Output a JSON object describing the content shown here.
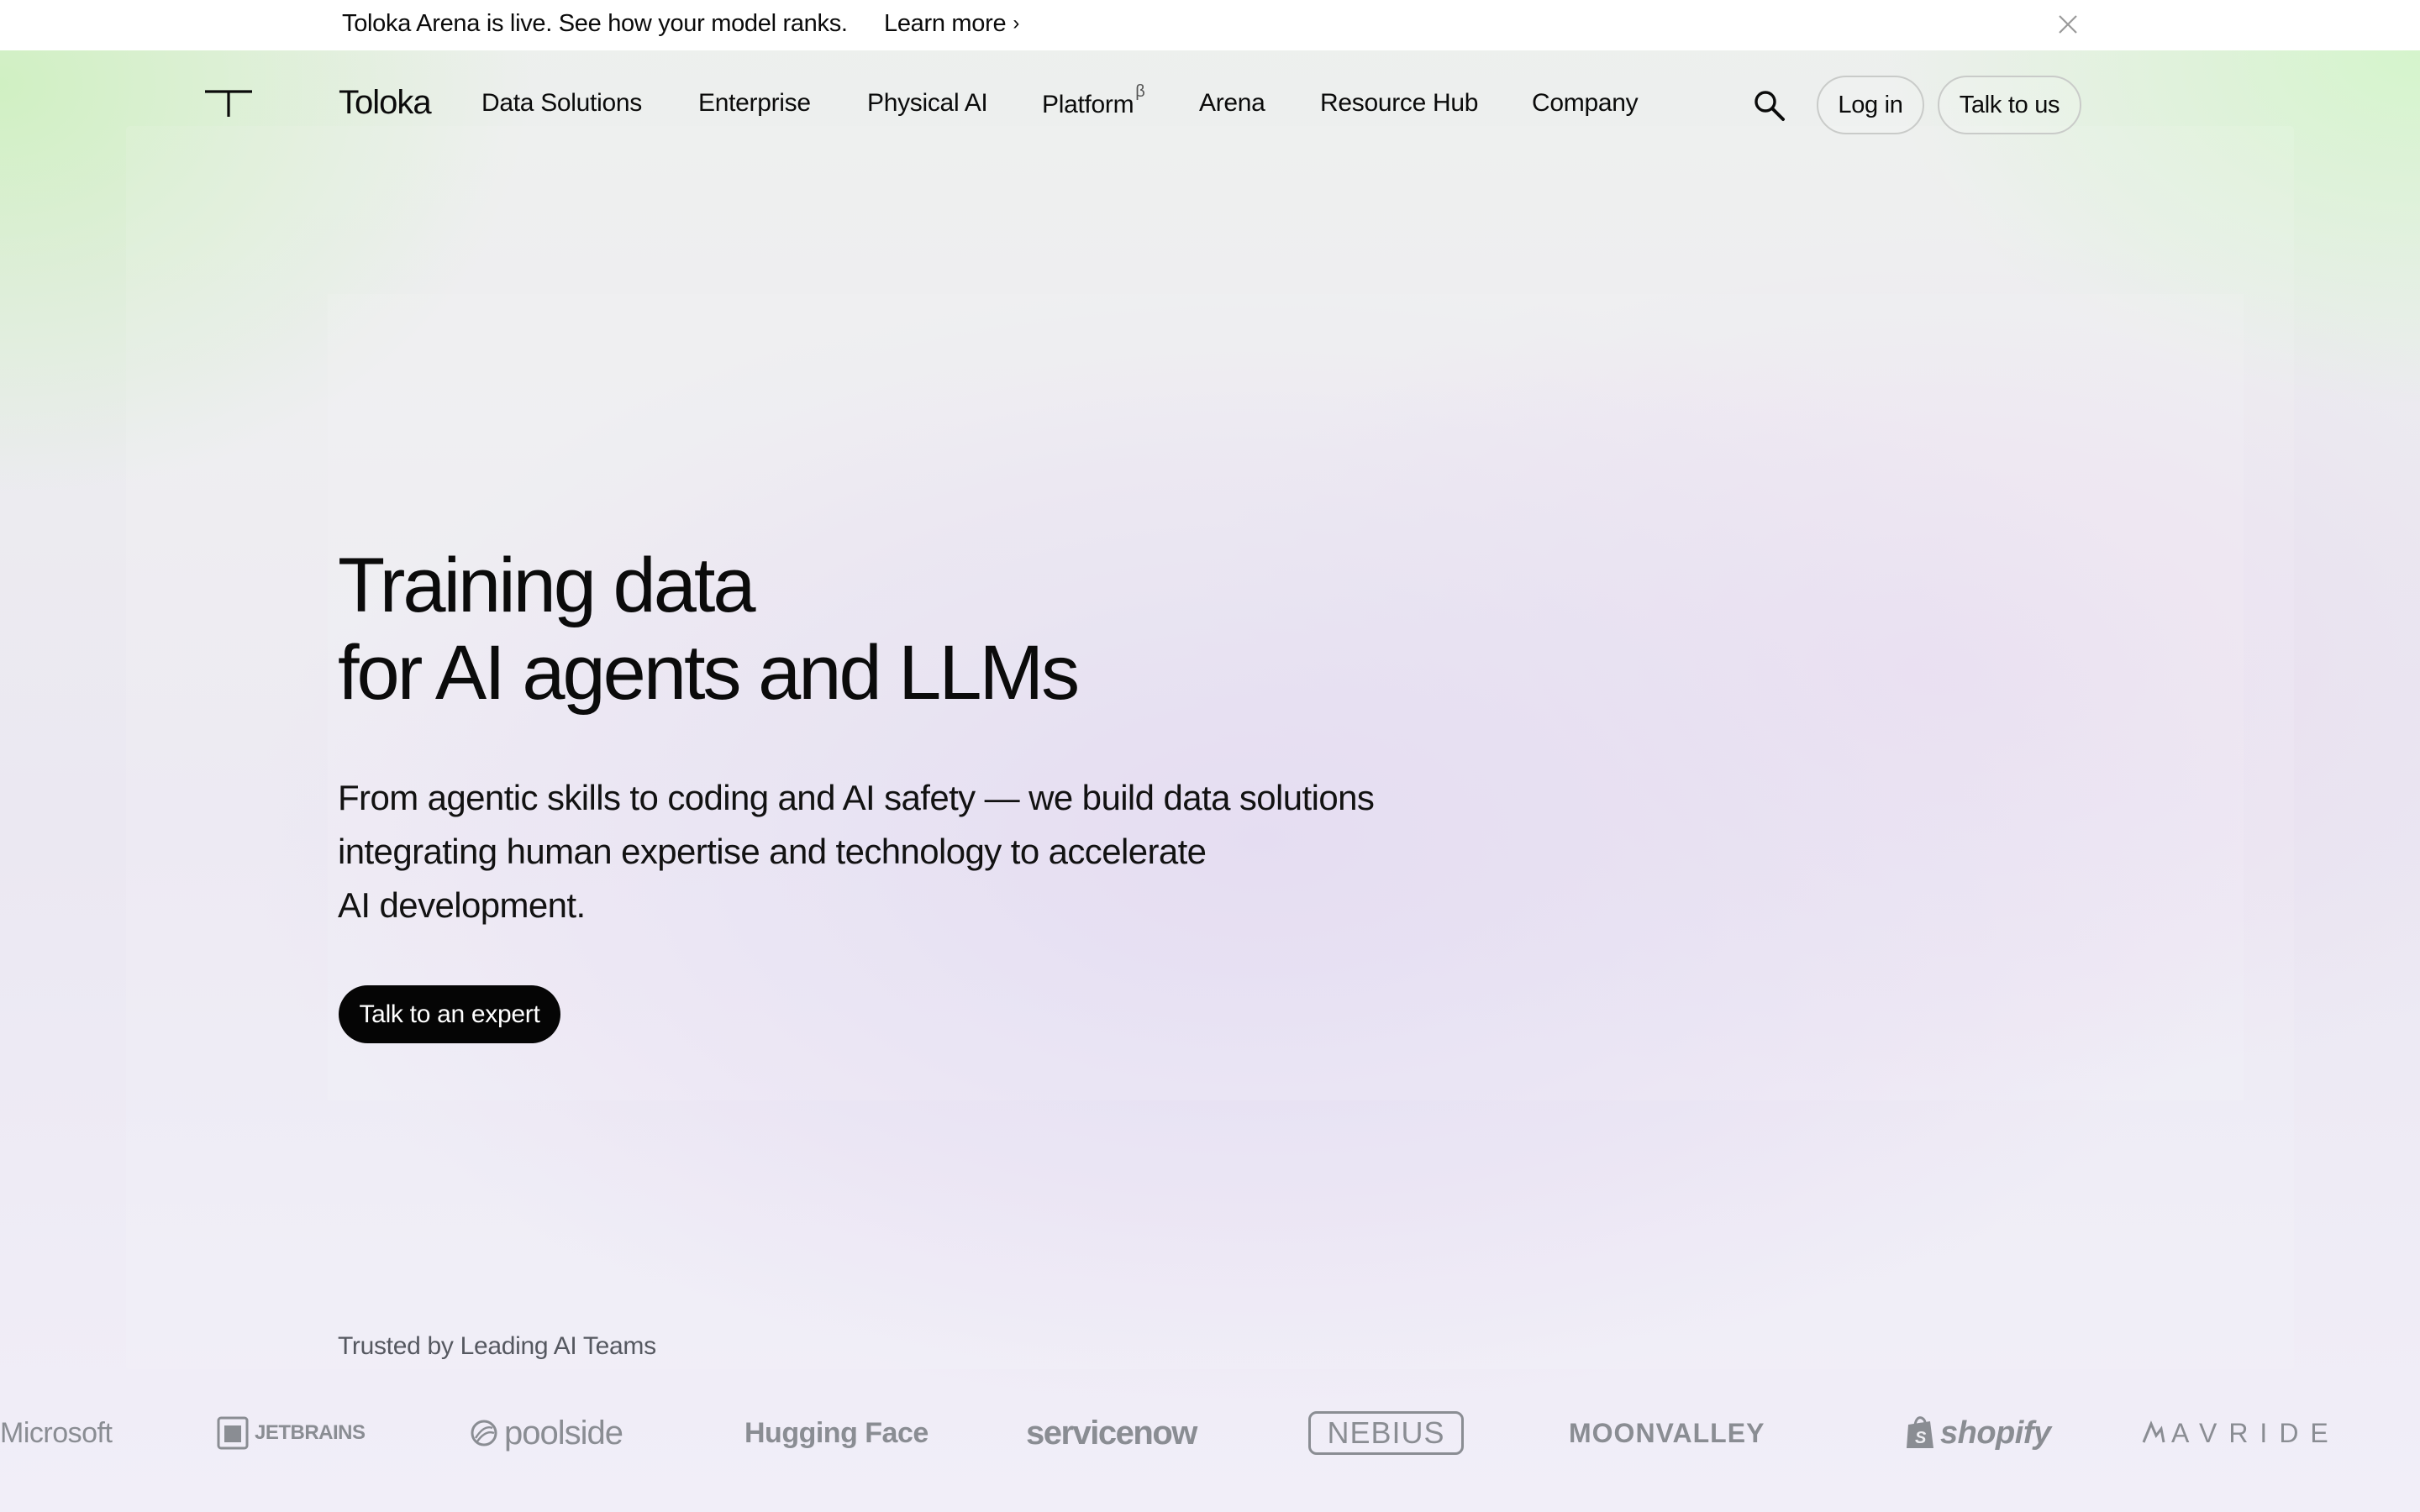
{
  "announcement": {
    "text": "Toloka Arena is live. See how your model ranks.",
    "link_label": "Learn more",
    "link_chevron": "›",
    "close_icon": "close-icon"
  },
  "header": {
    "brand": "Toloka",
    "logo_icon": "toloka-t-logo",
    "nav": [
      {
        "label": "Data Solutions"
      },
      {
        "label": "Enterprise"
      },
      {
        "label": "Physical AI"
      },
      {
        "label": "Platform",
        "superscript": "β"
      },
      {
        "label": "Arena"
      },
      {
        "label": "Resource Hub"
      },
      {
        "label": "Company"
      }
    ],
    "search_icon": "search-icon",
    "login_label": "Log in",
    "talk_label": "Talk to us"
  },
  "hero": {
    "title_line1": "Training data",
    "title_line2": "for AI agents and LLMs",
    "subtitle_line1": "From agentic skills to coding and AI safety — we build data solutions",
    "subtitle_line2": "integrating human expertise and technology to accelerate",
    "subtitle_line3": "AI development.",
    "cta_label": "Talk to an expert"
  },
  "trusted": {
    "heading": "Trusted by Leading AI Teams",
    "logos": [
      {
        "name": "Microsoft"
      },
      {
        "name": "JETBRAINS"
      },
      {
        "name": "poolside"
      },
      {
        "name": "Hugging Face"
      },
      {
        "name": "servicenow"
      },
      {
        "name": "NEBIUS"
      },
      {
        "name": "MOONVALLEY"
      },
      {
        "name": "shopify"
      },
      {
        "name": "AVRIDE"
      }
    ]
  },
  "colors": {
    "cta_background": "#050505",
    "logo_gray": "#8a8d93",
    "accent_green": "#cdf0be",
    "accent_lavender": "#e0d6f0"
  }
}
